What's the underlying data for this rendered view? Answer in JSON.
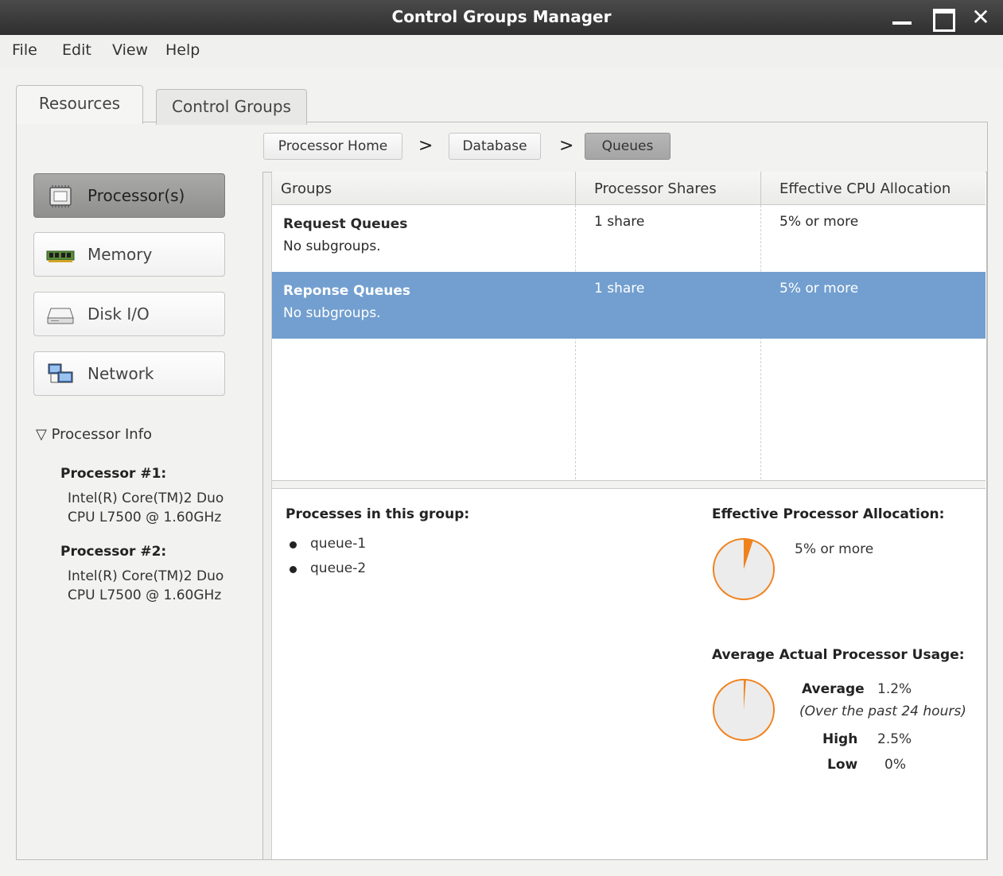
{
  "window": {
    "title": "Control Groups Manager"
  },
  "menu": [
    "File",
    "Edit",
    "View",
    "Help"
  ],
  "tabs": [
    "Resources",
    "Control Groups"
  ],
  "breadcrumb": [
    "Processor Home",
    "Database",
    "Queues"
  ],
  "breadcrumb_separator": ">",
  "resources": [
    {
      "label": "Processor(s)",
      "icon": "processor-chip-icon",
      "active": true
    },
    {
      "label": "Memory",
      "icon": "memory-module-icon",
      "active": false
    },
    {
      "label": "Disk I/O",
      "icon": "hard-disk-icon",
      "active": false
    },
    {
      "label": "Network",
      "icon": "network-computers-icon",
      "active": false
    }
  ],
  "processor_info": {
    "heading": "Processor Info",
    "processors": [
      {
        "name": "Processor #1:",
        "line1": "Intel(R) Core(TM)2 Duo",
        "line2": "CPU L7500  @ 1.60GHz"
      },
      {
        "name": "Processor #2:",
        "line1": "Intel(R) Core(TM)2 Duo",
        "line2": "CPU L7500  @ 1.60GHz"
      }
    ]
  },
  "groups_table": {
    "columns": [
      "Groups",
      "Processor Shares",
      "Effective CPU Allocation"
    ],
    "rows": [
      {
        "name": "Request Queues",
        "sub": "No subgroups.",
        "shares": "1 share",
        "alloc": "5% or more",
        "selected": false
      },
      {
        "name": "Reponse Queues",
        "sub": "No subgroups.",
        "shares": "1 share",
        "alloc": "5% or more",
        "selected": true
      }
    ]
  },
  "details": {
    "processes_heading": "Processes in this group:",
    "processes": [
      "queue-1",
      "queue-2"
    ],
    "allocation_heading": "Effective Processor Allocation:",
    "allocation_value": "5% or more",
    "allocation_fraction": 0.05,
    "usage_heading": "Average Actual Processor Usage:",
    "average_label": "Average",
    "average_value": "1.2%",
    "average_note": "(Over the past 24 hours)",
    "high_label": "High",
    "high_value": "2.5%",
    "low_label": "Low",
    "low_value": "0%",
    "usage_fraction": 0.012
  },
  "colors": {
    "selection": "#729fcf",
    "pie_accent": "#f0821e"
  }
}
